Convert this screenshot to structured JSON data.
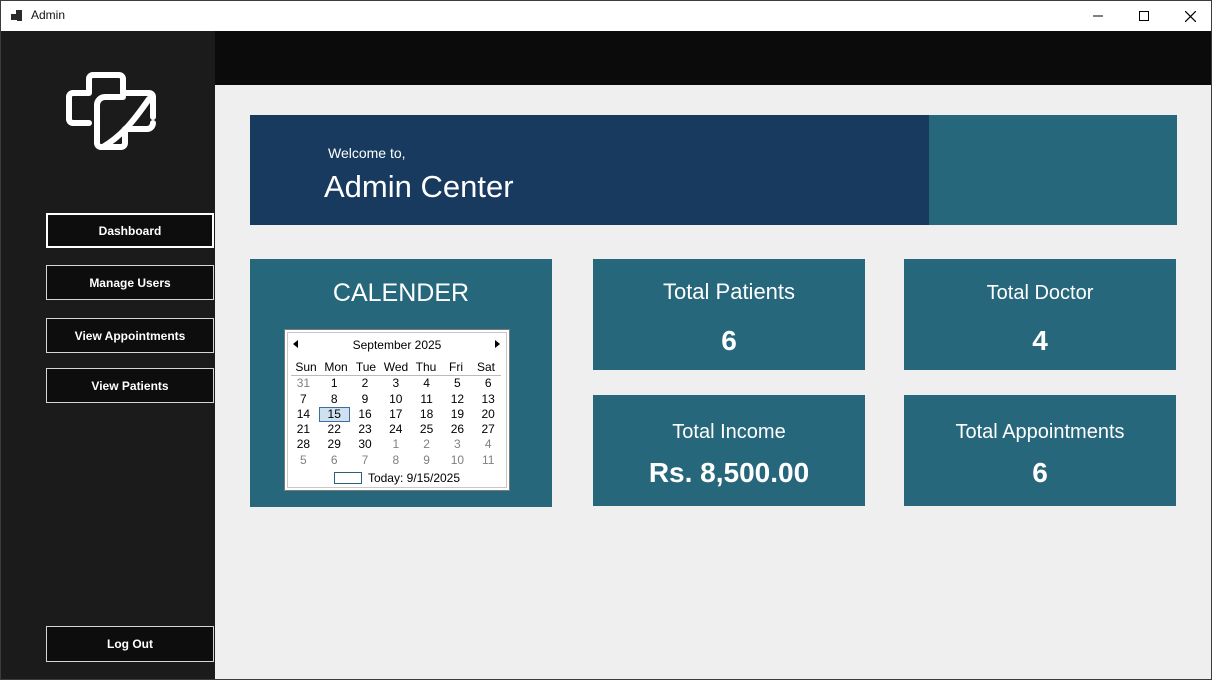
{
  "window": {
    "title": "Admin"
  },
  "sidebar": {
    "buttons": [
      {
        "label": "Dashboard"
      },
      {
        "label": "Manage Users"
      },
      {
        "label": "View Appointments"
      },
      {
        "label": "View Patients"
      }
    ],
    "logout_label": "Log Out"
  },
  "banner": {
    "small": "Welcome to,",
    "big": "Admin Center"
  },
  "calendar": {
    "heading": "CALENDER",
    "month": "September 2025",
    "days": [
      "Sun",
      "Mon",
      "Tue",
      "Wed",
      "Thu",
      "Fri",
      "Sat"
    ],
    "weeks": [
      [
        "31",
        "1",
        "2",
        "3",
        "4",
        "5",
        "6"
      ],
      [
        "7",
        "8",
        "9",
        "10",
        "11",
        "12",
        "13"
      ],
      [
        "14",
        "15",
        "16",
        "17",
        "18",
        "19",
        "20"
      ],
      [
        "21",
        "22",
        "23",
        "24",
        "25",
        "26",
        "27"
      ],
      [
        "28",
        "29",
        "30",
        "1",
        "2",
        "3",
        "4"
      ],
      [
        "5",
        "6",
        "7",
        "8",
        "9",
        "10",
        "11"
      ]
    ],
    "selected": "15",
    "today": "Today: 9/15/2025"
  },
  "stats": {
    "patients": {
      "title": "Total Patients",
      "value": "6"
    },
    "doctors": {
      "title": "Total Doctor",
      "value": "4"
    },
    "income": {
      "title": "Total Income",
      "value": "Rs. 8,500.00"
    },
    "appointments": {
      "title": "Total Appointments",
      "value": "6"
    }
  },
  "colors": {
    "sidebar": "#1b1b1b",
    "banner": "#173a5e",
    "card": "#27677b",
    "content_bg": "#efefef"
  }
}
